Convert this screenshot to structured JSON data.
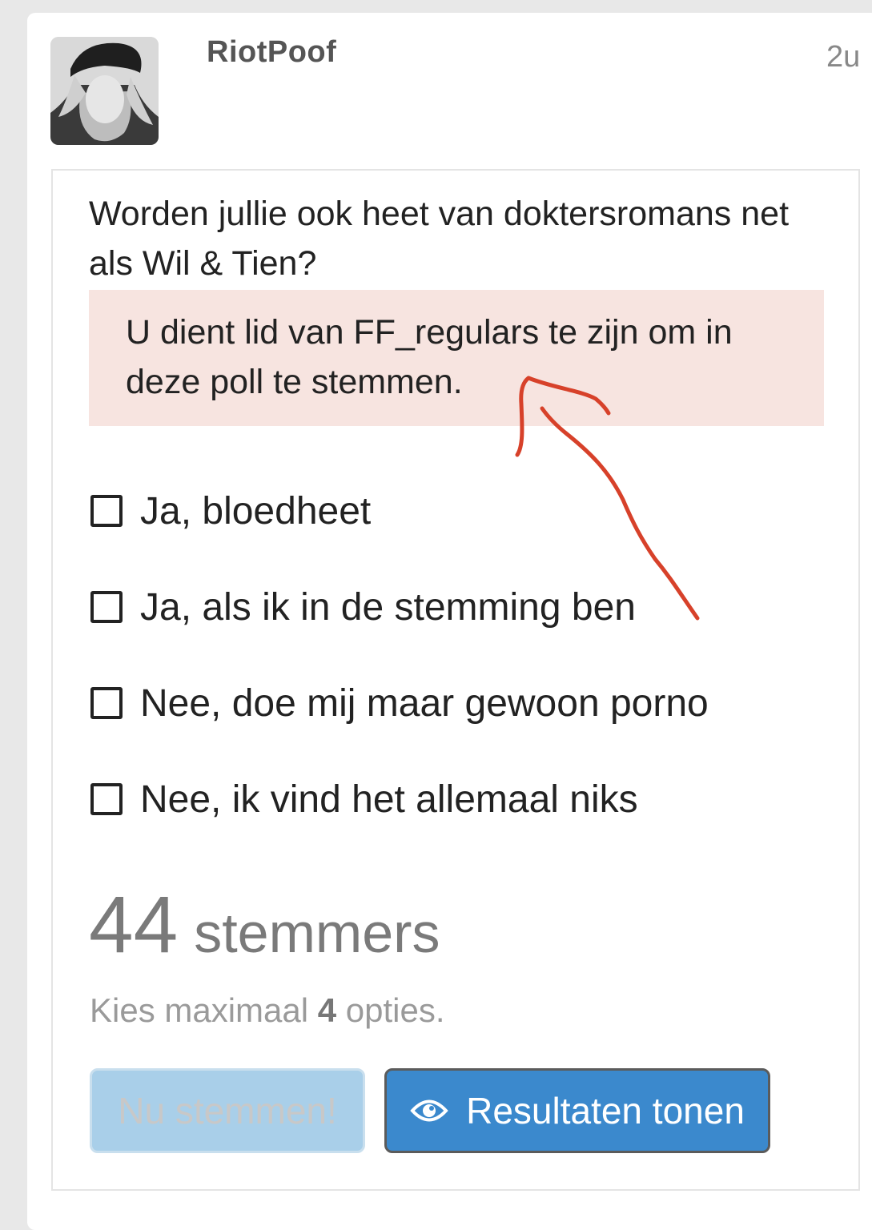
{
  "post": {
    "username": "RiotPoof",
    "timestamp": "2u"
  },
  "poll": {
    "question": "Worden jullie ook heet van doktersromans net als Wil & Tien?",
    "alert_text": "U dient lid van FF_regulars te zijn om in deze poll te stemmen.",
    "options": [
      "Ja, bloedheet",
      "Ja, als ik in de stemming ben",
      "Nee, doe mij maar gewoon porno",
      "Nee, ik vind het allemaal niks"
    ],
    "voters_count": "44",
    "voters_label": "stemmers",
    "max_prefix": "Kies maximaal",
    "max_number": "4",
    "max_suffix": "opties.",
    "vote_button": "Nu stemmen!",
    "results_button": "Resultaten tonen"
  },
  "icons": {
    "results_button_icon": "eye-icon"
  },
  "colors": {
    "alert_background": "#f7e4e0",
    "primary_button": "#3b89cd",
    "disabled_button": "#a9cfe9",
    "annotation_arrow": "#d7412a"
  }
}
